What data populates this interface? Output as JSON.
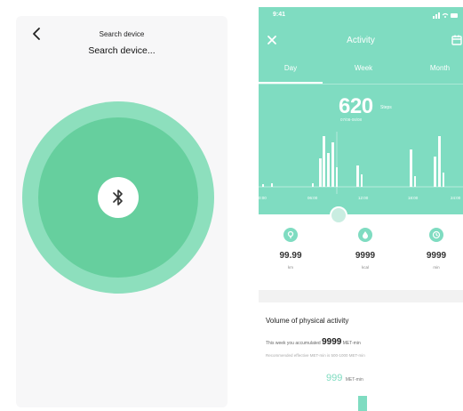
{
  "left": {
    "title": "Search device",
    "subtitle": "Search device..."
  },
  "right": {
    "status_time": "9:41",
    "title": "Activity",
    "tabs": [
      "Day",
      "Week",
      "Month"
    ],
    "steps_value": "620",
    "steps_unit": "Steps",
    "steps_sub": "07/08-08/08",
    "chart_axis": [
      "0:00",
      "06:00",
      "12:00",
      "18:00",
      "24:00"
    ],
    "stats": [
      {
        "value": "99.99",
        "unit": "km"
      },
      {
        "value": "9999",
        "unit": "kcal"
      },
      {
        "value": "9999",
        "unit": "min"
      }
    ],
    "volume_title": "Volume of physical activity",
    "week_prefix": "This week you accumulated",
    "week_value": "9999",
    "week_unit": "MET-min",
    "recommend": "Recommended effective MET-min is 500-1000 MET-min",
    "met_value": "999",
    "met_unit": "MET-min"
  },
  "colors": {
    "accent": "#7fdcc1",
    "circle_outer": "#8ddfbd",
    "circle_inner": "#66cf9e"
  }
}
